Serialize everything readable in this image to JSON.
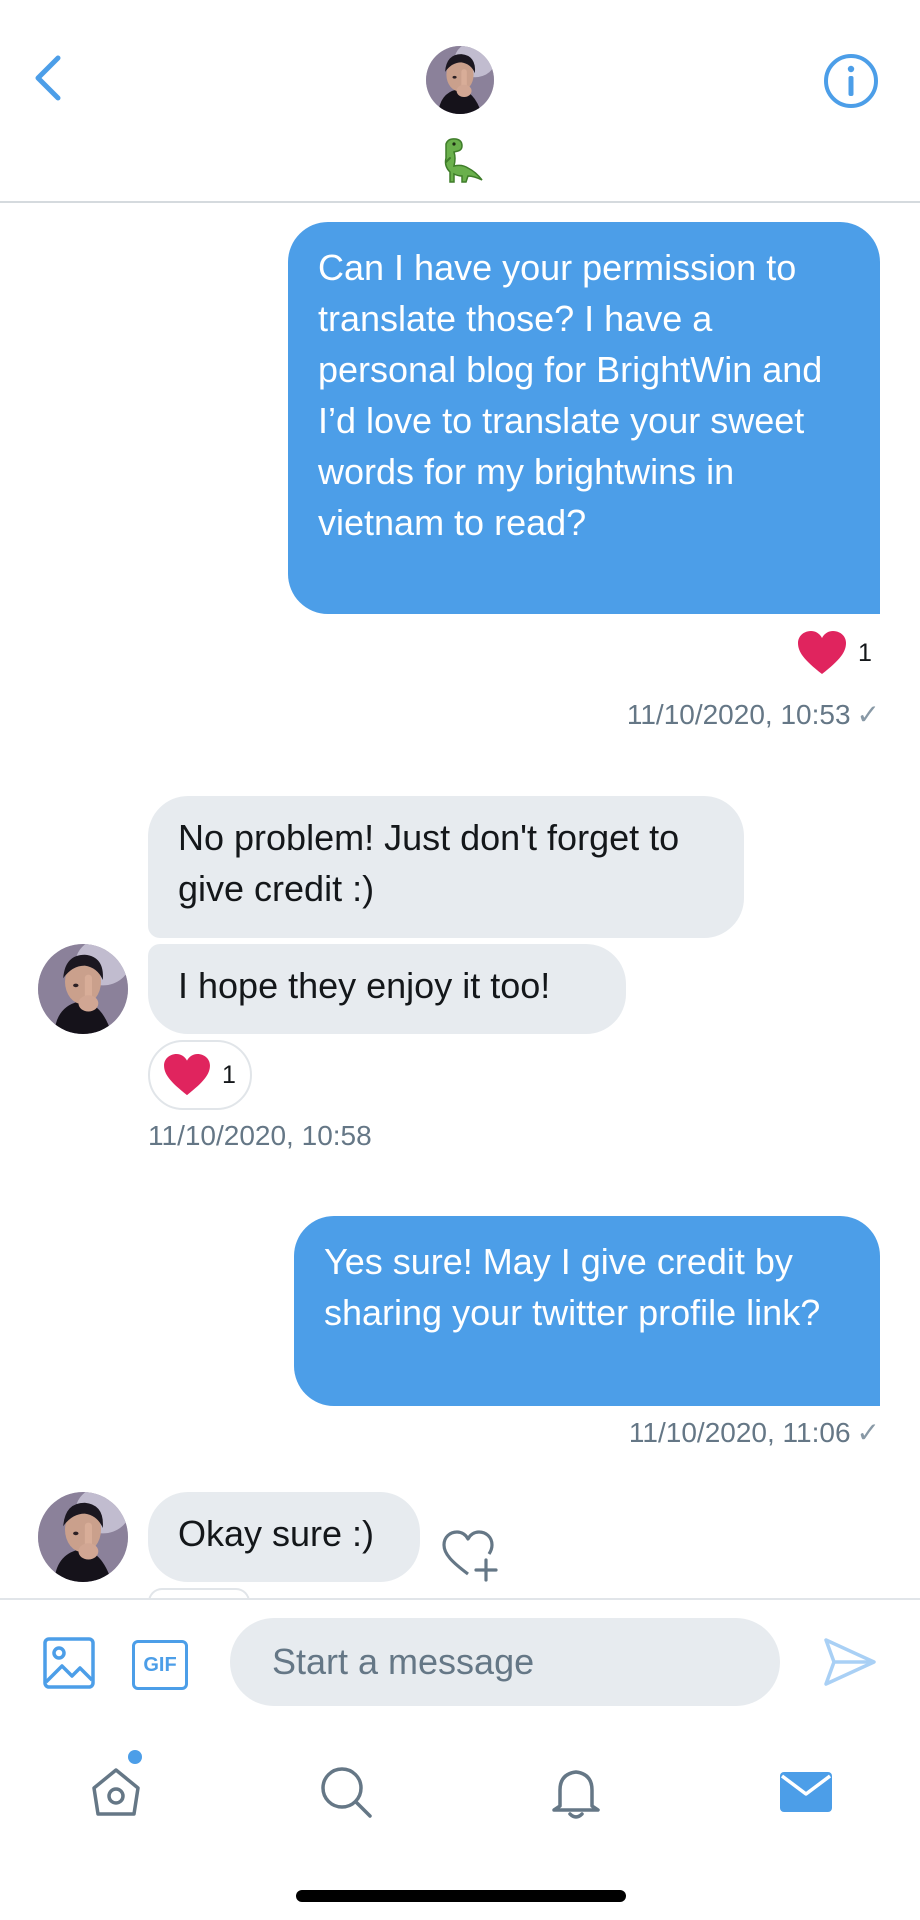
{
  "header": {
    "back_icon": "chevron-left-icon",
    "info_icon": "info-circle-icon",
    "emoji_icon": "t-rex-emoji"
  },
  "colors": {
    "accent": "#4c9ee8",
    "bubble_in": "#e7ebef",
    "heart": "#e0245e",
    "meta_text": "#657786"
  },
  "messages": [
    {
      "direction": "out",
      "text": "Can I have your permission to translate those? I have a personal blog for BrightWin and I’d love to translate your sweet words for my brightwins in vietnam to read?",
      "reaction_count": "1",
      "timestamp": "11/10/2020, 10:53"
    },
    {
      "direction": "in",
      "text": "No problem! Just don't forget to give credit :)"
    },
    {
      "direction": "in",
      "text": "I hope they enjoy it too!",
      "reaction_count": "1",
      "timestamp": "11/10/2020, 10:58"
    },
    {
      "direction": "out",
      "text": "Yes sure! May I give credit by sharing your twitter profile link?",
      "timestamp": "11/10/2020, 11:06"
    },
    {
      "direction": "in",
      "text": "Okay sure :)"
    }
  ],
  "composer": {
    "placeholder": "Start a message",
    "gif_label": "GIF",
    "media_icon": "image-icon",
    "send_icon": "send-icon"
  },
  "tabbar": {
    "items": [
      "home-icon",
      "search-icon",
      "bell-icon",
      "mail-icon"
    ],
    "active": "mail-icon",
    "home_has_notification": true
  }
}
